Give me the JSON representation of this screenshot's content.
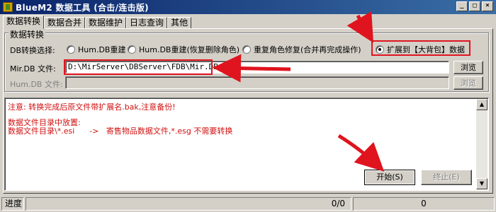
{
  "window": {
    "title": "BlueM2 数据工具 (合击/连击版)",
    "minimize_glyph": "_",
    "maximize_glyph": "□",
    "close_glyph": "×"
  },
  "tabs": [
    {
      "label": "数据转换",
      "active": true
    },
    {
      "label": "数据合并",
      "active": false
    },
    {
      "label": "数据维护",
      "active": false
    },
    {
      "label": "日志查询",
      "active": false
    },
    {
      "label": "其他",
      "active": false
    }
  ],
  "group": {
    "title": "数据转换",
    "mode_label": "DB转换选择:",
    "options": [
      {
        "label": "Hum.DB重建",
        "selected": false
      },
      {
        "label": "Hum.DB重建(恢复删除角色)",
        "selected": false
      },
      {
        "label": "重复角色修复(合并再完成操作)",
        "selected": false
      },
      {
        "label": "扩展到【大背包】数据",
        "selected": true
      }
    ],
    "mir_label": "Mir.DB 文件:",
    "mir_value": "D:\\MirServer\\DBServer\\FDB\\Mir.DB",
    "hum_label": "Hum.DB 文件:",
    "hum_value": "",
    "browse_label": "浏览",
    "browse2_label": "浏览"
  },
  "memo": {
    "lines": [
      "注意: 转换完成后原文件带扩展名.bak,注意备份!",
      "",
      "数据文件目录中放置:",
      "数据文件目录\\*.esi      ->   寄售物品数据文件,*.esg 不需要转换"
    ]
  },
  "actions": {
    "start_label": "开始(S)",
    "stop_label": "终止(E)"
  },
  "status": {
    "label": "进度",
    "counter": "0/0",
    "value": "0"
  },
  "colors": {
    "highlight_red": "#e0141e",
    "log_text_red": "#d01010",
    "title_bar": "#0a246a"
  }
}
